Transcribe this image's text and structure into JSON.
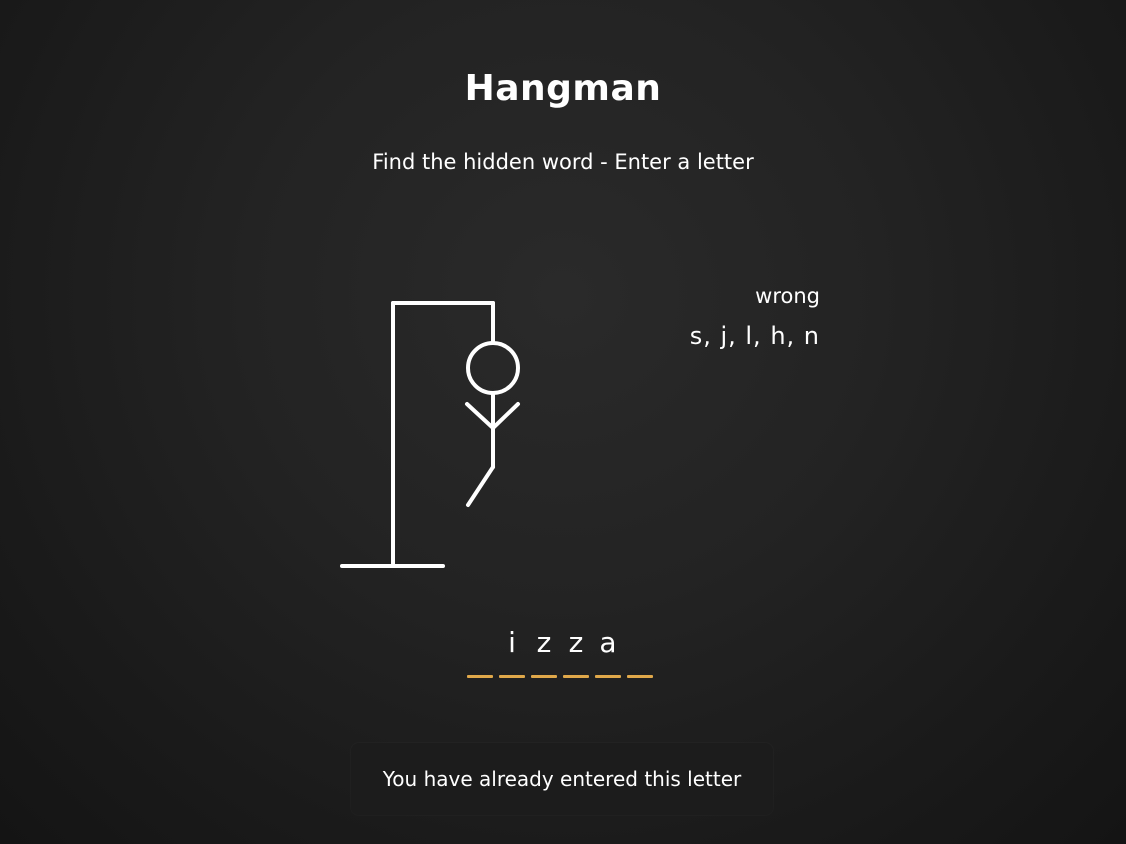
{
  "header": {
    "title": "Hangman",
    "subtitle": "Find the hidden word - Enter a letter"
  },
  "wrong_panel": {
    "label": "wrong",
    "letters": "s, j, l, h, n"
  },
  "word": {
    "slots": [
      "",
      "i",
      "z",
      "z",
      "a",
      ""
    ]
  },
  "notification": {
    "message": "You have already entered this letter"
  },
  "colors": {
    "background": "#1e1e1e",
    "text": "#ffffff",
    "slot_underline": "#e0a84a",
    "notification_bg": "#1c1c1c",
    "drawing_stroke": "#ffffff"
  }
}
